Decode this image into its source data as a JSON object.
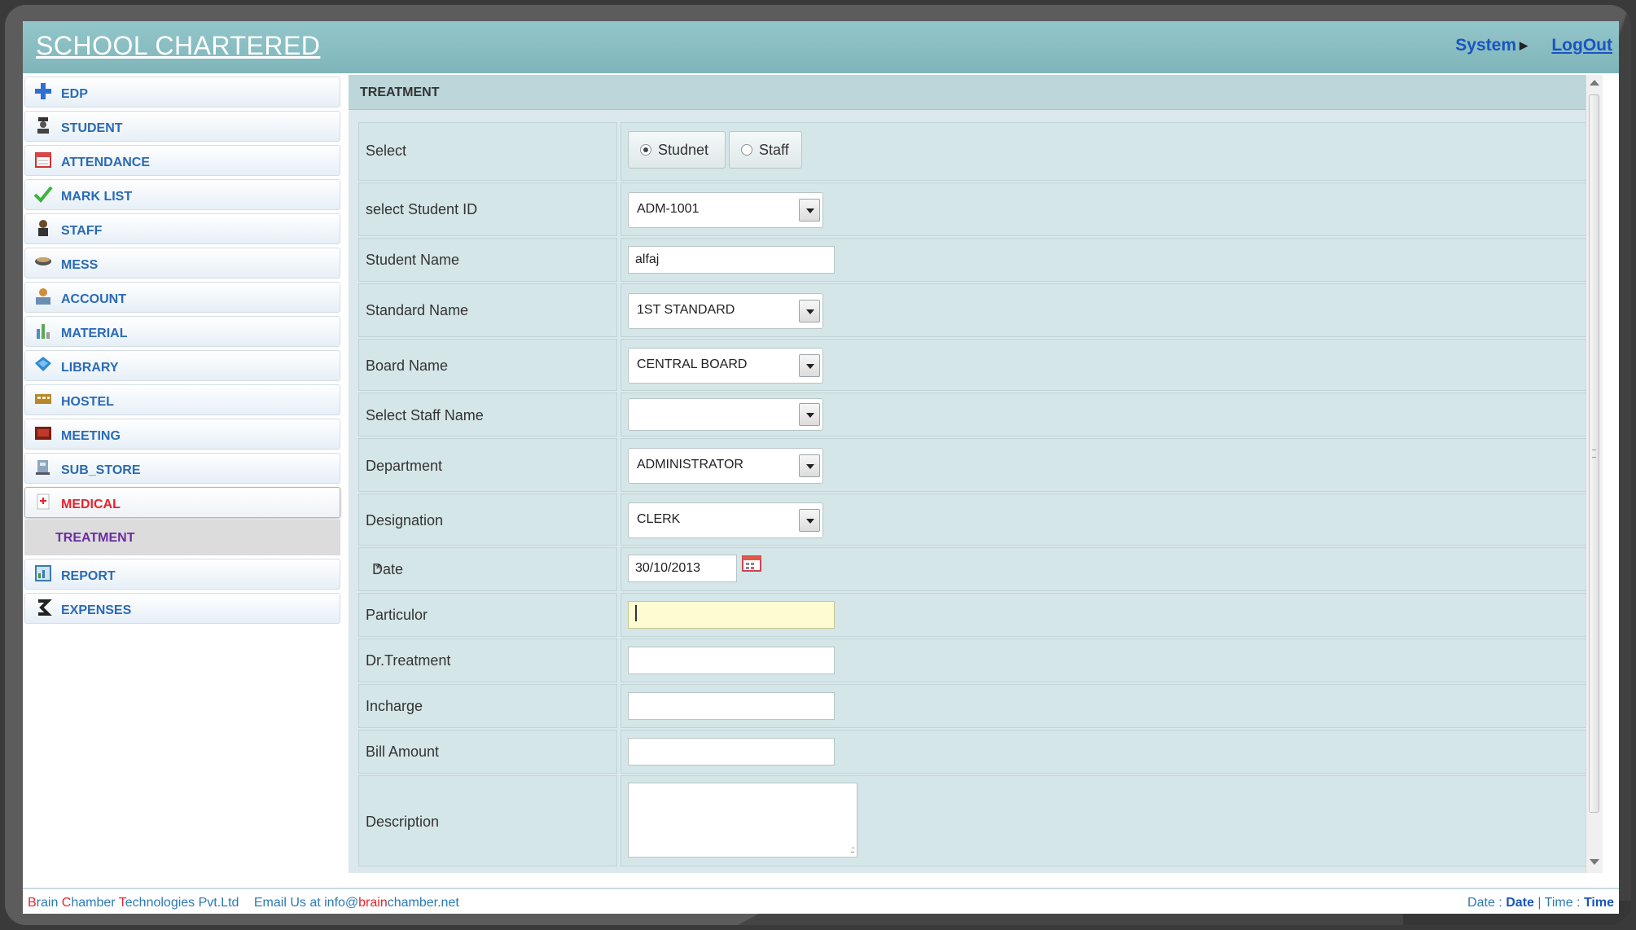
{
  "header": {
    "app_title": "SCHOOL CHARTERED",
    "system_menu": "System",
    "logout": "LogOut"
  },
  "sidebar": {
    "items": [
      {
        "label": "EDP",
        "icon": "plus-icon"
      },
      {
        "label": "STUDENT",
        "icon": "student-icon"
      },
      {
        "label": "ATTENDANCE",
        "icon": "calendar-icon"
      },
      {
        "label": "MARK LIST",
        "icon": "check-icon"
      },
      {
        "label": "STAFF",
        "icon": "staff-icon"
      },
      {
        "label": "MESS",
        "icon": "bowl-icon"
      },
      {
        "label": "ACCOUNT",
        "icon": "account-icon"
      },
      {
        "label": "MATERIAL",
        "icon": "material-icon"
      },
      {
        "label": "LIBRARY",
        "icon": "book-icon"
      },
      {
        "label": "HOSTEL",
        "icon": "hostel-icon"
      },
      {
        "label": "MEETING",
        "icon": "meeting-icon"
      },
      {
        "label": "SUB_STORE",
        "icon": "store-icon"
      },
      {
        "label": "MEDICAL",
        "icon": "medical-icon"
      },
      {
        "label": "REPORT",
        "icon": "report-icon"
      },
      {
        "label": "EXPENSES",
        "icon": "expenses-icon"
      }
    ],
    "active_item": "MEDICAL",
    "sub_item": "TREATMENT"
  },
  "panel": {
    "title": "TREATMENT"
  },
  "form": {
    "select_label": "Select",
    "radio_student": "Studnet",
    "radio_staff": "Staff",
    "selected_radio": "Studnet",
    "student_id_label": "select Student ID",
    "student_id_value": "ADM-1001",
    "student_name_label": "Student Name",
    "student_name_value": "alfaj",
    "standard_label": "Standard Name",
    "standard_value": "1ST STANDARD",
    "board_label": "Board Name",
    "board_value": "CENTRAL BOARD",
    "staff_name_label": "Select Staff Name",
    "staff_name_value": "",
    "department_label": "Department",
    "department_value": "ADMINISTRATOR",
    "designation_label": "Designation",
    "designation_value": "CLERK",
    "date_label": "Date",
    "date_required": "*",
    "date_value": "30/10/2013",
    "particular_label": "Particulor",
    "particular_value": "",
    "treatment_label": "Dr.Treatment",
    "treatment_value": "",
    "incharge_label": "Incharge",
    "incharge_value": "",
    "bill_label": "Bill Amount",
    "bill_value": "",
    "description_label": "Description",
    "description_value": ""
  },
  "footer": {
    "company_b": "B",
    "company_rain": "rain ",
    "company_c": "C",
    "company_hamber": "hamber ",
    "company_t": "T",
    "company_rest": "echnologies Pvt.Ltd",
    "email_prefix": "Email Us at info@",
    "email_brain": "brain",
    "email_suffix": "chamber.net",
    "date_label": "Date : ",
    "date_value": "Date",
    "sep": " | ",
    "time_label": "Time : ",
    "time_value": "Time"
  },
  "colors": {
    "header_bg": "#7fb5ba",
    "link_blue": "#1a55c0",
    "active_red": "#e8232a",
    "sub_item_purple": "#6a2da0",
    "form_bg": "#dce9ec",
    "focus_yellow": "#fcfbd2"
  }
}
